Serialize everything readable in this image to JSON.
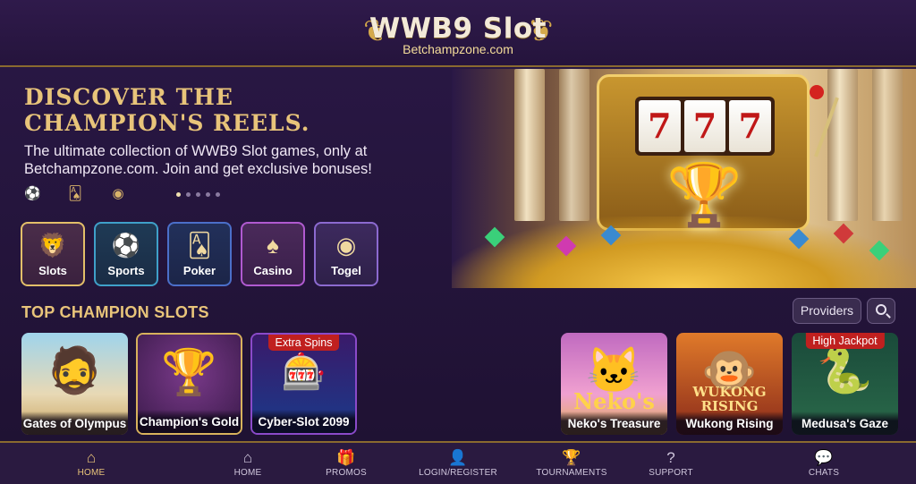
{
  "header": {
    "logo_title": "WWB9 Slot",
    "logo_subtitle": "Betchampzone.com"
  },
  "hero": {
    "title": "DISCOVER THE CHAMPION'S REELS.",
    "description": "The ultimate collection of WWB9 Slot games, only at Betchampzone.com. Join and get exclusive bonuses!",
    "slide_count": 5,
    "active_slide": 1,
    "reels": [
      "7",
      "7",
      "7"
    ]
  },
  "categories": [
    {
      "label": "Slots",
      "icon": "lion-icon"
    },
    {
      "label": "Sports",
      "icon": "soccer-ball-icon"
    },
    {
      "label": "Poker",
      "icon": "playing-cards-icon"
    },
    {
      "label": "Casino",
      "icon": "casino-chip-icon"
    },
    {
      "label": "Togel",
      "icon": "lottery-ball-icon"
    }
  ],
  "top_slots": {
    "title": "TOP CHAMPION SLOTS",
    "providers_label": "Providers",
    "games": [
      {
        "name": "Gates of Olympus",
        "tag": ""
      },
      {
        "name": "Champion's Gold",
        "tag": ""
      },
      {
        "name": "Cyber-Slot 2099",
        "tag": "Extra Spins"
      },
      {
        "name": "Neko's Treasure",
        "tag": "",
        "art_text": "Neko's"
      },
      {
        "name": "Wukong Rising",
        "tag": "",
        "art_text": "WUKONG RISING"
      },
      {
        "name": "Medusa's Gaze",
        "tag": "High Jackpot"
      }
    ]
  },
  "bottom_nav": [
    {
      "label": "HOME",
      "icon": "home-icon",
      "active": true
    },
    {
      "label": "HOME",
      "icon": "home-icon",
      "active": false
    },
    {
      "label": "PROMOS",
      "icon": "gift-icon",
      "active": false
    },
    {
      "label": "LOGIN/REGISTER",
      "icon": "user-plus-icon",
      "active": false
    },
    {
      "label": "TOURNAMENTS",
      "icon": "trophy-icon",
      "active": false
    },
    {
      "label": "SUPPORT",
      "icon": "question-icon",
      "active": false
    },
    {
      "label": "CHATS",
      "icon": "chat-icon",
      "active": false
    }
  ],
  "colors": {
    "accent_gold": "#e8c47a",
    "background": "#1f1233",
    "tag_red": "#c0201f"
  }
}
